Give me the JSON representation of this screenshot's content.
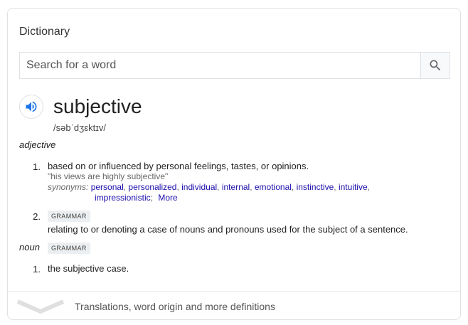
{
  "card": {
    "title": "Dictionary",
    "search": {
      "placeholder": "Search for a word",
      "value": ""
    },
    "entry": {
      "word": "subjective",
      "phonetic": "/səbˈdʒɛktɪv/",
      "senses": [
        {
          "pos": "adjective",
          "definitions": [
            {
              "number": "1.",
              "text": "based on or influenced by personal feelings, tastes, or opinions.",
              "example": "\"his views are highly subjective\"",
              "synonyms_label": "synonyms:",
              "synonyms": [
                "personal",
                "personalized",
                "individual",
                "internal",
                "emotional",
                "instinctive",
                "intuitive",
                "impressionistic"
              ],
              "more_label": "More"
            },
            {
              "number": "2.",
              "tag": "GRAMMAR",
              "text": "relating to or denoting a case of nouns and pronouns used for the subject of a sentence."
            }
          ]
        },
        {
          "pos": "noun",
          "tag": "GRAMMAR",
          "definitions": [
            {
              "number": "1.",
              "text": "the subjective case."
            }
          ]
        }
      ]
    },
    "footer": {
      "label": "Translations, word origin and more definitions"
    }
  },
  "colors": {
    "link": "#1a0dab",
    "speaker": "#1a73e8",
    "border": "#dfe1e5"
  },
  "icons": {
    "search": "search-icon",
    "speaker": "speaker-icon",
    "expand": "chevron-down-icon"
  }
}
